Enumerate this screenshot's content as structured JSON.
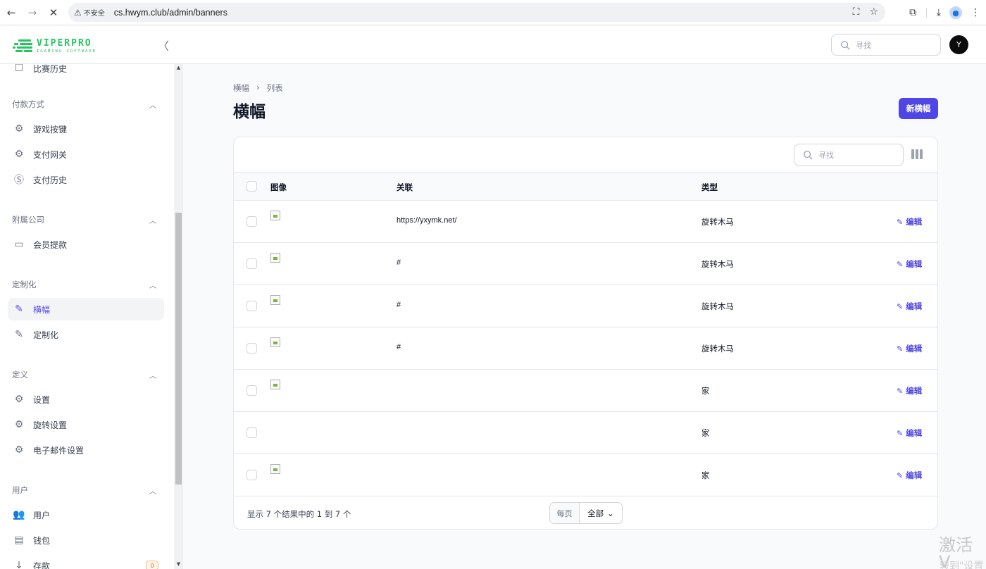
{
  "browser": {
    "security_label": "不安全",
    "url": "cs.hwym.club/admin/banners"
  },
  "header": {
    "logo_title": "VIPERPRO",
    "logo_subtitle": "IGAMING SOFTWARE",
    "search_placeholder": "寻找",
    "avatar_initial": "Y"
  },
  "sidebar": {
    "partial_item": "比赛历史",
    "groups": [
      {
        "title": "付款方式",
        "items": [
          "游戏按键",
          "支付网关",
          "支付历史"
        ]
      },
      {
        "title": "附属公司",
        "items": [
          "会员提款"
        ]
      },
      {
        "title": "定制化",
        "items": [
          "横幅",
          "定制化"
        ]
      },
      {
        "title": "定义",
        "items": [
          "设置",
          "旋转设置",
          "电子邮件设置"
        ]
      },
      {
        "title": "用户",
        "items": [
          "用户",
          "钱包",
          "存款"
        ]
      }
    ],
    "active_item": "横幅",
    "deposit_badge": "0"
  },
  "main": {
    "breadcrumb": [
      "横幅",
      "列表"
    ],
    "title": "横幅",
    "new_button": "新横幅",
    "table": {
      "search_placeholder": "寻找",
      "columns": [
        "图像",
        "关联",
        "类型"
      ],
      "rows": [
        {
          "link": "https://yxymk.net/",
          "type": "旋转木马",
          "has_image": true
        },
        {
          "link": "#",
          "type": "旋转木马",
          "has_image": true
        },
        {
          "link": "#",
          "type": "旋转木马",
          "has_image": true
        },
        {
          "link": "#",
          "type": "旋转木马",
          "has_image": true
        },
        {
          "link": "",
          "type": "家",
          "has_image": true
        },
        {
          "link": "",
          "type": "家",
          "has_image": false
        },
        {
          "link": "",
          "type": "家",
          "has_image": true
        }
      ],
      "edit_label": "编辑",
      "footer_text": "显示 7 个结果中的 1 到 7 个",
      "per_page_label": "每页",
      "per_page_value": "全部"
    }
  },
  "watermark": {
    "line1": "激活 V",
    "line2": "转到\"设置"
  },
  "colors": {
    "accent": "#4f46e5",
    "brand_green": "#22c55e"
  }
}
